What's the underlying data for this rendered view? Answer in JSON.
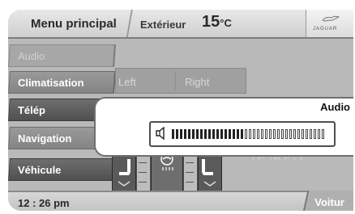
{
  "header": {
    "title": "Menu principal",
    "exterior_label": "Extérieur",
    "temp_value": "15",
    "temp_unit": "°C",
    "logo_text": "JAGUAR"
  },
  "sidebar": {
    "items": [
      {
        "label": "Audio",
        "state": "dim"
      },
      {
        "label": "Climatisation",
        "state": "active"
      },
      {
        "label": "Télép",
        "state": "dark"
      },
      {
        "label": "Navigation",
        "state": "active"
      },
      {
        "label": "Véhicule",
        "state": "dark"
      }
    ]
  },
  "climate": {
    "left_label": "Left",
    "right_label": "Right",
    "ghost_text": "TP TA PTY"
  },
  "popup": {
    "title": "Audio",
    "volume_fraction": 0.48
  },
  "footer": {
    "time": "12 : 26 pm",
    "vehicle_tab": "Voitur"
  }
}
